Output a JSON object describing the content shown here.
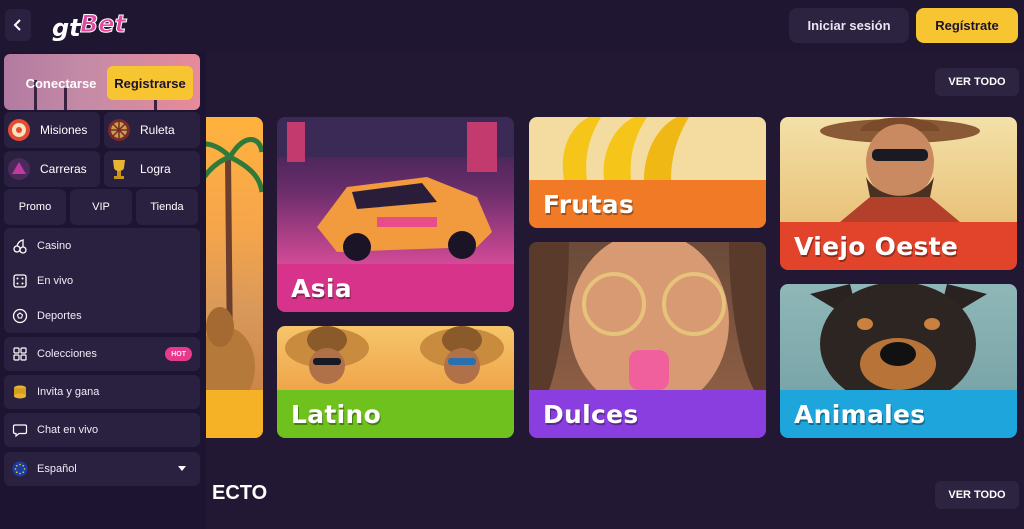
{
  "header": {
    "logo_text": "gtBet",
    "login_label": "Iniciar sesión",
    "register_label": "Regístrate"
  },
  "sidebar": {
    "connect_label": "Conectarse",
    "register_label": "Registrarse",
    "tiles": [
      {
        "label": "Misiones",
        "icon": "target-icon"
      },
      {
        "label": "Ruleta",
        "icon": "wheel-icon"
      },
      {
        "label": "Carreras",
        "icon": "race-icon"
      },
      {
        "label": "Logra",
        "icon": "trophy-icon"
      }
    ],
    "mini_buttons": [
      "Promo",
      "VIP",
      "Tienda"
    ],
    "menu": {
      "games": [
        "Casino",
        "En vivo",
        "Deportes"
      ],
      "colecciones": "Colecciones",
      "hot_badge": "HOT",
      "invite": "Invita y gana",
      "chat": "Chat en vivo",
      "language": "Español"
    }
  },
  "main": {
    "view_all_top": "VER TODO",
    "view_all_bottom": "VER TODO",
    "section2_title_partial": "ECTO",
    "categories": [
      {
        "name": "Asia",
        "color": "#d8338a"
      },
      {
        "name": "Latino",
        "color": "#6fc11d"
      },
      {
        "name": "Frutas",
        "color": "#f07a25"
      },
      {
        "name": "Dulces",
        "color": "#8a3ee0"
      },
      {
        "name": "Viejo Oeste",
        "color": "#e2432b"
      },
      {
        "name": "Animales",
        "color": "#1ea6dc"
      }
    ]
  },
  "colors": {
    "accent": "#f7c531",
    "background": "#221833",
    "panel": "#2a2140",
    "hot": "#e83a8c"
  }
}
